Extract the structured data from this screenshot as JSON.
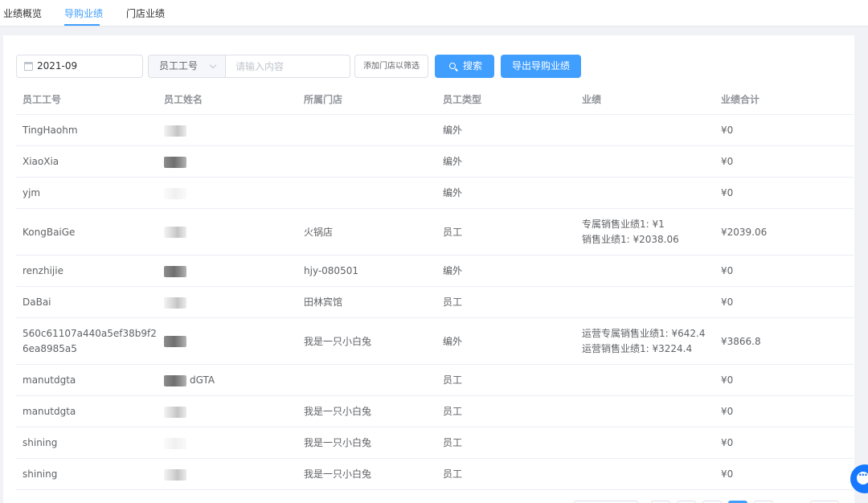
{
  "tabs": [
    {
      "label": "业绩概览"
    },
    {
      "label": "导购业绩"
    },
    {
      "label": "门店业绩"
    }
  ],
  "active_tab_index": 1,
  "toolbar": {
    "date_value": "2021-09",
    "field_select_value": "员工工号",
    "keyword_placeholder": "请输入内容",
    "store_filter_label": "添加门店以筛选",
    "search_label": "搜索",
    "export_label": "导出导购业绩"
  },
  "table": {
    "headers": [
      "员工工号",
      "员工姓名",
      "所属门店",
      "员工类型",
      "业绩",
      "业绩合计"
    ],
    "rows": [
      {
        "id": "TingHaohm",
        "name_suffix": "",
        "store": "",
        "type": "编外",
        "perf": [],
        "total": "¥0"
      },
      {
        "id": "XiaoXia",
        "name_suffix": "",
        "store": "",
        "type": "编外",
        "perf": [],
        "total": "¥0"
      },
      {
        "id": "yjm",
        "name_suffix": "",
        "store": "",
        "type": "编外",
        "perf": [],
        "total": "¥0"
      },
      {
        "id": "KongBaiGe",
        "name_suffix": "",
        "store": "火锅店",
        "type": "员工",
        "perf": [
          "专属销售业绩1: ¥1",
          "销售业绩1: ¥2038.06"
        ],
        "total": "¥2039.06"
      },
      {
        "id": "renzhijie",
        "name_suffix": "",
        "store": "hjy-080501",
        "type": "编外",
        "perf": [],
        "total": "¥0"
      },
      {
        "id": "DaBai",
        "name_suffix": "",
        "store": "田林宾馆",
        "type": "员工",
        "perf": [],
        "total": "¥0"
      },
      {
        "id": "560c61107a440a5ef38b9f26ea8985a5",
        "name_suffix": "",
        "store": "我是一只小白兔",
        "type": "编外",
        "perf": [
          "运营专属销售业绩1: ¥642.4",
          "运营销售业绩1: ¥3224.4"
        ],
        "total": "¥3866.8"
      },
      {
        "id": "manutdgta",
        "name_suffix": "dGTA",
        "store": "",
        "type": "员工",
        "perf": [],
        "total": "¥0"
      },
      {
        "id": "manutdgta",
        "name_suffix": "",
        "store": "我是一只小白兔",
        "type": "员工",
        "perf": [],
        "total": "¥0"
      },
      {
        "id": "shining",
        "name_suffix": "",
        "store": "我是一只小白兔",
        "type": "员工",
        "perf": [],
        "total": "¥0"
      },
      {
        "id": "shining",
        "name_suffix": "",
        "store": "我是一只小白兔",
        "type": "员工",
        "perf": [],
        "total": "¥0"
      }
    ]
  },
  "colors": {
    "accent": "#409eff",
    "border": "#ebeef5",
    "header_text": "#909399",
    "body_text": "#606266",
    "chat_fab": "#1677ff"
  },
  "icons": [
    "calendar-icon",
    "chevron-down-icon",
    "search-icon",
    "chat-icon"
  ]
}
